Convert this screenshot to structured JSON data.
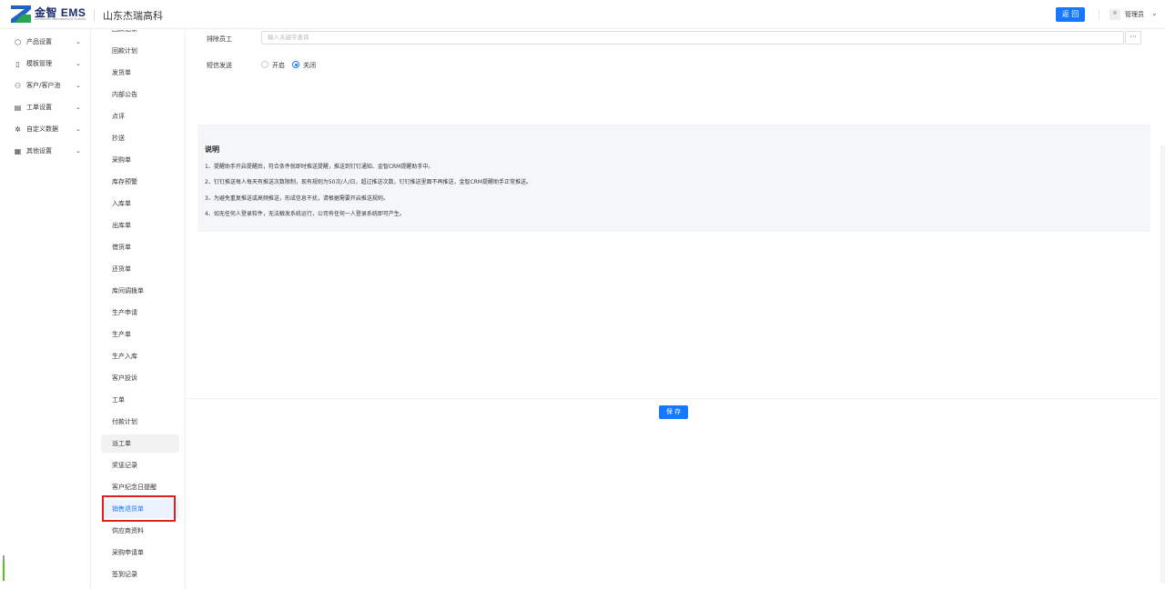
{
  "header": {
    "logo_text": "金智 EMS",
    "logo_subtext": "Enterprise Management System",
    "company": "山东杰瑞高科",
    "back_label": "返 回",
    "user_name": "管理员",
    "user_caret": "⌄"
  },
  "sidebar": {
    "items": [
      {
        "icon": "⬡",
        "icon_name": "cube-icon",
        "label": "产品设置"
      },
      {
        "icon": "▯",
        "icon_name": "template-icon",
        "label": "模板管理"
      },
      {
        "icon": "⚇",
        "icon_name": "customers-icon",
        "label": "客户/客户池"
      },
      {
        "icon": "▤",
        "icon_name": "work-order-icon",
        "label": "工单设置"
      },
      {
        "icon": "✲",
        "icon_name": "custom-data-icon",
        "label": "自定义数据"
      },
      {
        "icon": "▦",
        "icon_name": "grid-icon",
        "label": "其他设置"
      }
    ],
    "caret": "⌄"
  },
  "submenu": {
    "items": [
      "回款记录",
      "回款计划",
      "发货单",
      "内部公告",
      "点评",
      "抄送",
      "采购单",
      "库存预警",
      "入库单",
      "出库单",
      "借货单",
      "还货单",
      "库间调拨单",
      "生产申请",
      "生产单",
      "生产入库",
      "客户投诉",
      "工单",
      "付款计划",
      "派工单",
      "奖惩记录",
      "客户纪念日提醒",
      "销售退货单",
      "供应商资料",
      "采购申请单",
      "签到记录"
    ],
    "hover_index": 19,
    "active_index": 22
  },
  "form": {
    "exclude_label": "排除员工",
    "exclude_placeholder": "输入关键字查询",
    "more_label": "···",
    "sms_label": "短信发送",
    "sms_on": "开启",
    "sms_off": "关闭",
    "sms_selected": "关闭"
  },
  "note": {
    "title": "说明",
    "lines": [
      "1、提醒助手开启提醒后，符合条件就即时推送提醒，推送到钉钉通知、金智CRM提醒助手中。",
      "2、钉钉推送每人每天有推送次数限制，现有规则为50次/人/日，超过推送次数，钉钉推送里面不再推送，金智CRM提醒助手正常推送。",
      "3、为避免重复推送或高频推送，形成信息干扰，请根据需要开启推送规则。",
      "4、如无任何人登录软件，无法触发系统运行，公司有任何一人登录系统即可产生。"
    ]
  },
  "footer": {
    "save_label": "保 存"
  },
  "colors": {
    "accent": "#1677ff",
    "highlight_box": "#e02020"
  }
}
